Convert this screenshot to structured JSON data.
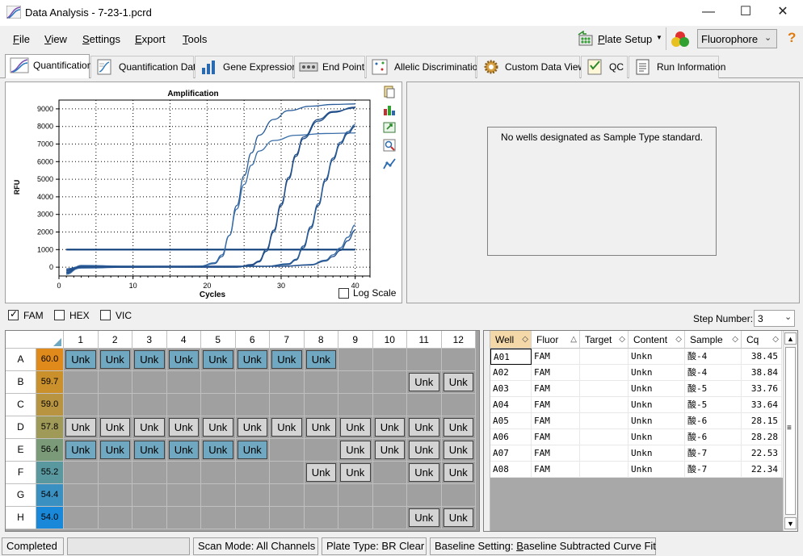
{
  "window": {
    "title": "Data Analysis - 7-23-1.pcrd",
    "minimize": "—",
    "maximize": "☐",
    "close": "✕"
  },
  "menu": {
    "items": [
      {
        "label": "File",
        "accel": "F",
        "rest": "ile"
      },
      {
        "label": "View",
        "accel": "V",
        "rest": "iew"
      },
      {
        "label": "Settings",
        "accel": "S",
        "rest": "ettings"
      },
      {
        "label": "Export",
        "accel": "E",
        "rest": "xport"
      },
      {
        "label": "Tools",
        "accel": "T",
        "rest": "ools"
      }
    ],
    "plate_setup": "Plate Setup",
    "plate_setup_accel": "P",
    "plate_setup_rest": "late Setup",
    "fluorophore": "Fluorophore",
    "help": "?"
  },
  "tabs": [
    {
      "label": "Quantification",
      "icon": "amplification-curve-icon",
      "active": true
    },
    {
      "label": "Quantification Data",
      "icon": "data-sheet-icon"
    },
    {
      "label": "Gene Expression",
      "icon": "bar-chart-icon"
    },
    {
      "label": "End Point",
      "icon": "wells-icon"
    },
    {
      "label": "Allelic Discrimination",
      "icon": "scatter-grid-icon"
    },
    {
      "label": "Custom Data View",
      "icon": "gear-icon"
    },
    {
      "label": "QC",
      "icon": "checklist-icon"
    },
    {
      "label": "Run Information",
      "icon": "document-icon"
    }
  ],
  "chart_data": {
    "type": "line",
    "title": "Amplification",
    "xlabel": "Cycles",
    "ylabel": "RFU",
    "xlim": [
      0,
      42
    ],
    "ylim": [
      -500,
      9500
    ],
    "xticks": [
      0,
      10,
      20,
      30,
      40
    ],
    "yticks": [
      0,
      1000,
      2000,
      3000,
      4000,
      5000,
      6000,
      7000,
      8000,
      9000
    ],
    "grid": true,
    "threshold": 1000,
    "series": [
      {
        "values": [
          [
            1,
            -350
          ],
          [
            3,
            0
          ],
          [
            10,
            0
          ],
          [
            19,
            50
          ],
          [
            21,
            200
          ],
          [
            22,
            600
          ],
          [
            23,
            1800
          ],
          [
            24,
            3500
          ],
          [
            25,
            5200
          ],
          [
            26,
            6500
          ],
          [
            27,
            7500
          ],
          [
            29,
            8400
          ],
          [
            31,
            8900
          ],
          [
            34,
            9150
          ],
          [
            37,
            9250
          ],
          [
            40,
            9280
          ]
        ]
      },
      {
        "values": [
          [
            1,
            -250
          ],
          [
            3,
            -50
          ],
          [
            10,
            0
          ],
          [
            19,
            50
          ],
          [
            21,
            250
          ],
          [
            22,
            700
          ],
          [
            23,
            1800
          ],
          [
            24,
            3300
          ],
          [
            25,
            4700
          ],
          [
            26,
            5800
          ],
          [
            27,
            6600
          ],
          [
            29,
            7200
          ],
          [
            32,
            7500
          ],
          [
            36,
            7600
          ],
          [
            40,
            7630
          ]
        ]
      },
      {
        "values": [
          [
            1,
            -200
          ],
          [
            3,
            0
          ],
          [
            10,
            0
          ],
          [
            24,
            0
          ],
          [
            26,
            100
          ],
          [
            27,
            300
          ],
          [
            28,
            900
          ],
          [
            29,
            2000
          ],
          [
            30,
            3500
          ],
          [
            31,
            5000
          ],
          [
            32,
            6300
          ],
          [
            33,
            7300
          ],
          [
            35,
            8300
          ],
          [
            37,
            8800
          ],
          [
            40,
            9100
          ]
        ]
      },
      {
        "values": [
          [
            1,
            -150
          ],
          [
            3,
            0
          ],
          [
            10,
            0
          ],
          [
            24,
            0
          ],
          [
            26,
            150
          ],
          [
            27,
            350
          ],
          [
            28,
            1000
          ],
          [
            29,
            2100
          ],
          [
            30,
            3600
          ],
          [
            31,
            5100
          ],
          [
            32,
            6400
          ],
          [
            33,
            7400
          ],
          [
            35,
            8400
          ],
          [
            37,
            8850
          ],
          [
            40,
            9050
          ]
        ]
      },
      {
        "values": [
          [
            1,
            -300
          ],
          [
            3,
            50
          ],
          [
            10,
            50
          ],
          [
            28,
            50
          ],
          [
            31,
            150
          ],
          [
            32,
            400
          ],
          [
            33,
            1100
          ],
          [
            34,
            2200
          ],
          [
            35,
            3500
          ],
          [
            36,
            4900
          ],
          [
            37,
            6100
          ],
          [
            38,
            7000
          ],
          [
            39,
            7600
          ],
          [
            40,
            8000
          ]
        ]
      },
      {
        "values": [
          [
            1,
            -100
          ],
          [
            3,
            50
          ],
          [
            10,
            50
          ],
          [
            28,
            50
          ],
          [
            31,
            200
          ],
          [
            32,
            450
          ],
          [
            33,
            1200
          ],
          [
            34,
            2300
          ],
          [
            35,
            3600
          ],
          [
            36,
            5000
          ],
          [
            37,
            6200
          ],
          [
            38,
            7100
          ],
          [
            39,
            7700
          ],
          [
            40,
            8100
          ]
        ]
      },
      {
        "values": [
          [
            1,
            -400
          ],
          [
            3,
            100
          ],
          [
            10,
            50
          ],
          [
            30,
            50
          ],
          [
            34,
            150
          ],
          [
            36,
            400
          ],
          [
            37,
            700
          ],
          [
            38,
            1100
          ],
          [
            39,
            1700
          ],
          [
            40,
            2400
          ]
        ]
      },
      {
        "values": [
          [
            1,
            -300
          ],
          [
            3,
            50
          ],
          [
            10,
            50
          ],
          [
            30,
            50
          ],
          [
            34,
            120
          ],
          [
            36,
            350
          ],
          [
            37,
            600
          ],
          [
            38,
            950
          ],
          [
            39,
            1500
          ],
          [
            40,
            2100
          ]
        ]
      }
    ]
  },
  "log_scale": "Log Scale",
  "standard_message": "No wells designated as Sample Type standard.",
  "fluors": [
    {
      "label": "FAM",
      "checked": true
    },
    {
      "label": "HEX",
      "checked": false
    },
    {
      "label": "VIC",
      "checked": false
    }
  ],
  "step_label": "Step Number:",
  "step_value": "3",
  "plate": {
    "columns": [
      "1",
      "2",
      "3",
      "4",
      "5",
      "6",
      "7",
      "8",
      "9",
      "10",
      "11",
      "12"
    ],
    "rows": [
      {
        "label": "A",
        "temp": "60.0",
        "color": "#e08a1c",
        "wells": [
          "s",
          "s",
          "s",
          "s",
          "s",
          "s",
          "s",
          "s",
          "",
          "",
          "",
          ""
        ]
      },
      {
        "label": "B",
        "temp": "59.7",
        "color": "#c9902c",
        "wells": [
          "",
          "",
          "",
          "",
          "",
          "",
          "",
          "",
          "",
          "",
          "u",
          "u"
        ]
      },
      {
        "label": "C",
        "temp": "59.0",
        "color": "#b89440",
        "wells": [
          "",
          "",
          "",
          "",
          "",
          "",
          "",
          "",
          "",
          "",
          "",
          ""
        ]
      },
      {
        "label": "D",
        "temp": "57.8",
        "color": "#a09a58",
        "wells": [
          "u",
          "u",
          "u",
          "u",
          "u",
          "u",
          "u",
          "u",
          "u",
          "u",
          "u",
          "u"
        ]
      },
      {
        "label": "E",
        "temp": "56.4",
        "color": "#7a9a78",
        "wells": [
          "s",
          "s",
          "s",
          "s",
          "s",
          "s",
          "",
          "",
          "u",
          "u",
          "u",
          "u"
        ]
      },
      {
        "label": "F",
        "temp": "55.2",
        "color": "#5a98a0",
        "wells": [
          "",
          "",
          "",
          "",
          "",
          "",
          "",
          "u",
          "u",
          "",
          "u",
          "u"
        ]
      },
      {
        "label": "G",
        "temp": "54.4",
        "color": "#3a90c0",
        "wells": [
          "",
          "",
          "",
          "",
          "",
          "",
          "",
          "",
          "",
          "",
          "",
          ""
        ]
      },
      {
        "label": "H",
        "temp": "54.0",
        "color": "#1a88d8",
        "wells": [
          "",
          "",
          "",
          "",
          "",
          "",
          "",
          "",
          "",
          "",
          "u",
          "u"
        ]
      }
    ],
    "well_label": "Unk"
  },
  "table": {
    "headers": [
      "Well",
      "Fluor",
      "Target",
      "Content",
      "Sample",
      "Cq"
    ],
    "rows": [
      [
        "A01",
        "FAM",
        "",
        "Unkn",
        "酸-4",
        "38.45"
      ],
      [
        "A02",
        "FAM",
        "",
        "Unkn",
        "酸-4",
        "38.84"
      ],
      [
        "A03",
        "FAM",
        "",
        "Unkn",
        "酸-5",
        "33.76"
      ],
      [
        "A04",
        "FAM",
        "",
        "Unkn",
        "酸-5",
        "33.64"
      ],
      [
        "A05",
        "FAM",
        "",
        "Unkn",
        "酸-6",
        "28.15"
      ],
      [
        "A06",
        "FAM",
        "",
        "Unkn",
        "酸-6",
        "28.28"
      ],
      [
        "A07",
        "FAM",
        "",
        "Unkn",
        "酸-7",
        "22.53"
      ],
      [
        "A08",
        "FAM",
        "",
        "Unkn",
        "酸-7",
        "22.34"
      ]
    ]
  },
  "status": {
    "state": "Completed",
    "scan_mode": "Scan Mode: All Channels",
    "plate_type": "Plate Type: BR Clear",
    "baseline_prefix": "Baseline Setting: ",
    "baseline_accel": "B",
    "baseline_rest": "aseline Subtracted Curve Fit"
  }
}
